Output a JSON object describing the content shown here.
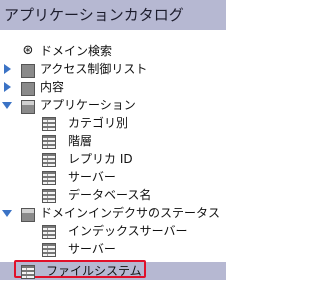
{
  "title": "アプリケーションカタログ",
  "tree": [
    {
      "label": "ドメイン検索",
      "icon": "search-icon"
    },
    {
      "label": "アクセス制御リスト",
      "icon": "folder-closed-icon",
      "expander": "collapsed"
    },
    {
      "label": "内容",
      "icon": "folder-closed-icon",
      "expander": "collapsed"
    },
    {
      "label": "アプリケーション",
      "icon": "folder-open-icon",
      "expander": "expanded"
    },
    {
      "label": "カテゴリ別",
      "icon": "table-icon"
    },
    {
      "label": "階層",
      "icon": "table-icon"
    },
    {
      "label": "レプリカ ID",
      "icon": "table-icon"
    },
    {
      "label": "サーバー",
      "icon": "table-icon"
    },
    {
      "label": "データベース名",
      "icon": "table-icon"
    },
    {
      "label": "ドメインインデクサのステータス",
      "icon": "folder-open-icon",
      "expander": "expanded"
    },
    {
      "label": "インデックスサーバー",
      "icon": "table-icon"
    },
    {
      "label": "サーバー",
      "icon": "table-icon"
    },
    {
      "label": "ファイルシステム",
      "icon": "table-icon",
      "selected": true
    }
  ],
  "colors": {
    "selection": "#b6b8d2",
    "highlight_border": "#e0102a",
    "expander": "#3b73c5"
  }
}
